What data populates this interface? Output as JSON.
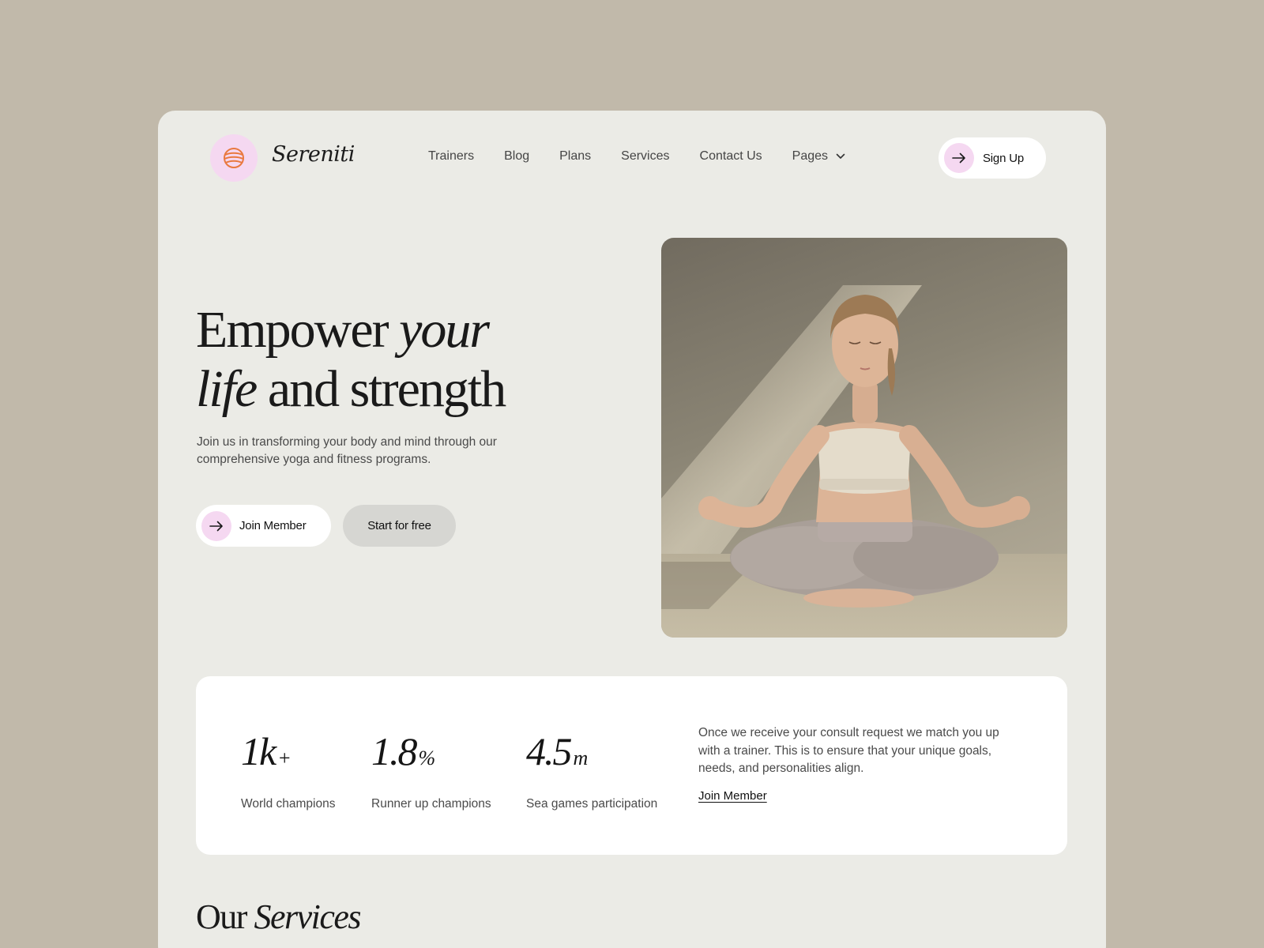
{
  "brand": {
    "name": "Sereniti",
    "logo_icon": "striped-ball-icon",
    "logo_color": "#e9793f",
    "logo_bg": "#f5d8f1"
  },
  "nav": {
    "items": [
      {
        "label": "Trainers"
      },
      {
        "label": "Blog"
      },
      {
        "label": "Plans"
      },
      {
        "label": "Services"
      },
      {
        "label": "Contact Us"
      },
      {
        "label": "Pages",
        "icon": "chevron-down-icon"
      }
    ],
    "signup_label": "Sign Up"
  },
  "hero": {
    "title_word1": "Empower",
    "title_word2": "your",
    "title_word3": "life",
    "title_word4": "and strength",
    "subtitle": "Join us in transforming your body and mind through our comprehensive yoga and fitness programs.",
    "primary_button": "Join Member",
    "secondary_button": "Start for free",
    "image_alt": "Woman meditating in lotus pose"
  },
  "stats": {
    "items": [
      {
        "value": "1k",
        "unit": "+",
        "label": "World champions"
      },
      {
        "value": "1.8",
        "unit": "%",
        "label": "Runner up champions"
      },
      {
        "value": "4.5",
        "unit": "m",
        "label": "Sea games participation"
      }
    ],
    "description": "Once we receive your consult request we match you up with a trainer. This is to ensure that your unique goals, needs, and personalities align.",
    "link_label": "Join Member"
  },
  "services": {
    "title_plain": "Our",
    "title_italic": "Services"
  },
  "colors": {
    "page_bg": "#c1b9aa",
    "card_bg": "#ebebe6",
    "accent_pink": "#f5d8f1"
  }
}
